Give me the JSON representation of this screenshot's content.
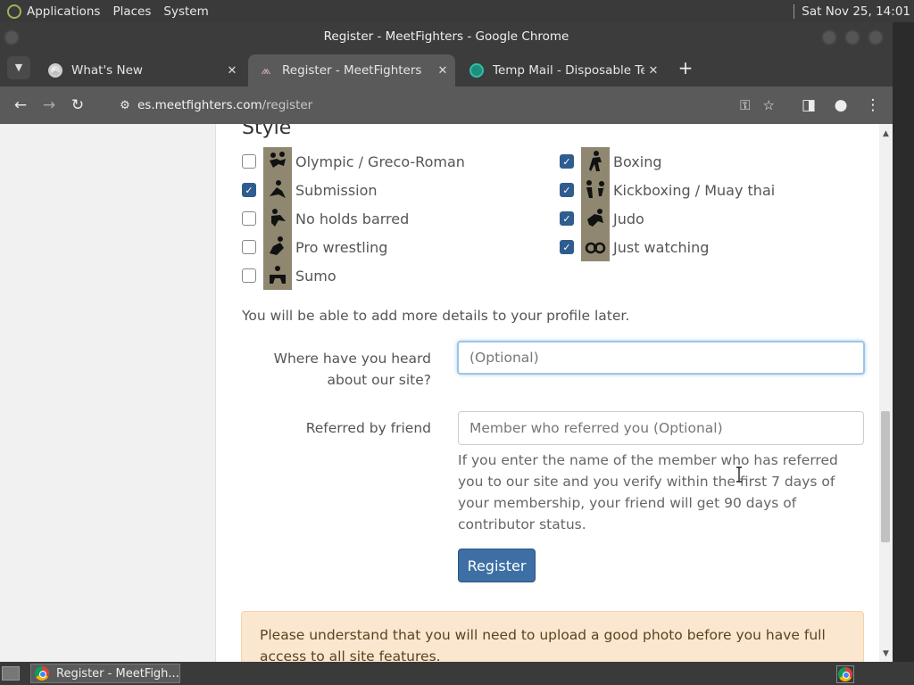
{
  "system_panel": {
    "menus": [
      "Applications",
      "Places",
      "System"
    ],
    "clock": "Sat Nov 25, 14:01"
  },
  "window": {
    "title": "Register - MeetFighters - Google Chrome"
  },
  "tabs": [
    {
      "title": "What's New",
      "favicon": "chrome-icon",
      "active": false
    },
    {
      "title": "Register - MeetFighters",
      "favicon": "meetfighters-icon",
      "active": true
    },
    {
      "title": "Temp Mail - Disposable Temporary Email",
      "favicon": "tempmail-icon",
      "active": false
    }
  ],
  "address_bar": {
    "host": "es.meetfighters.com",
    "path": "/register"
  },
  "form": {
    "style_heading": "Style",
    "styles_left": [
      {
        "label": "Olympic / Greco-Roman",
        "checked": false
      },
      {
        "label": "Submission",
        "checked": true
      },
      {
        "label": "No holds barred",
        "checked": false
      },
      {
        "label": "Pro wrestling",
        "checked": false
      },
      {
        "label": "Sumo",
        "checked": false
      }
    ],
    "styles_right": [
      {
        "label": "Boxing",
        "checked": true
      },
      {
        "label": "Kickboxing / Muay thai",
        "checked": true
      },
      {
        "label": "Judo",
        "checked": true
      },
      {
        "label": "Just watching",
        "checked": true
      }
    ],
    "details_note": "You will be able to add more details to your profile later.",
    "heard_label": "Where have you heard about our site?",
    "heard_placeholder": "(Optional)",
    "heard_value": "",
    "referred_label": "Referred by friend",
    "referred_placeholder": "Member who referred you (Optional)",
    "referred_value": "",
    "referred_help": "If you enter the name of the member who has referred you to our site and you verify within the first 7 days of your membership, your friend will get 90 days of contributor status.",
    "register_label": "Register",
    "photo_warning": "Please understand that you will need to upload a good photo before you have full access to all site features."
  },
  "taskbar": {
    "item_label": "Register - MeetFigh..."
  },
  "colors": {
    "checkbox_checked": "#2f5d8f",
    "button_primary": "#3d6fa5",
    "warning_bg": "#fbe7cf",
    "pictogram_bg": "#8f8770"
  }
}
